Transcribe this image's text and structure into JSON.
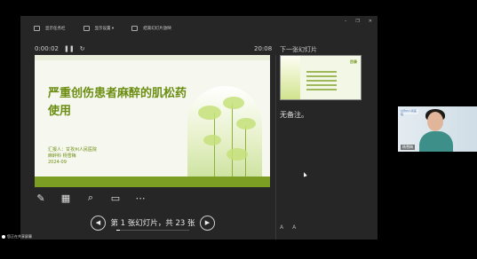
{
  "toolbar": {
    "items": [
      {
        "label": "显示任务栏",
        "icon": "taskbar-icon"
      },
      {
        "label": "显示设置 ▾",
        "icon": "display-settings-icon"
      },
      {
        "label": "结束幻灯片放映",
        "icon": "end-show-icon"
      }
    ],
    "window_controls": [
      "–",
      "❐",
      "✕"
    ]
  },
  "timer": {
    "elapsed": "0:00:02",
    "pause_icon": "pause-icon",
    "reset_icon": "reset-icon"
  },
  "clock": "20:08",
  "slide": {
    "title": "严重创伤患者麻醉的肌松药使用",
    "reporter": "汇报人：甘孜州人民医院",
    "department": "麻醉科 杨雪梅",
    "date": "2024-09"
  },
  "tools": [
    "pen-icon",
    "slides-grid-icon",
    "zoom-icon",
    "screen-icon",
    "more-icon"
  ],
  "navigation": {
    "prev_icon": "prev-icon",
    "next_icon": "next-icon",
    "page_info": "第 1 张幻灯片，共 23 张",
    "progress": 0.043
  },
  "next_slide": {
    "label": "下一张幻灯片",
    "thumb_title": "目录"
  },
  "notes": {
    "text": "无备注。"
  },
  "font_controls": [
    "A",
    "A"
  ],
  "webcam": {
    "name": "杨雪梅",
    "poster_text": "甘孜州人民医院"
  },
  "status": {
    "sharing": "您正在共享屏幕"
  },
  "colors": {
    "accent": "#7c9e22",
    "title": "#6b8e12",
    "panel": "#262626"
  }
}
